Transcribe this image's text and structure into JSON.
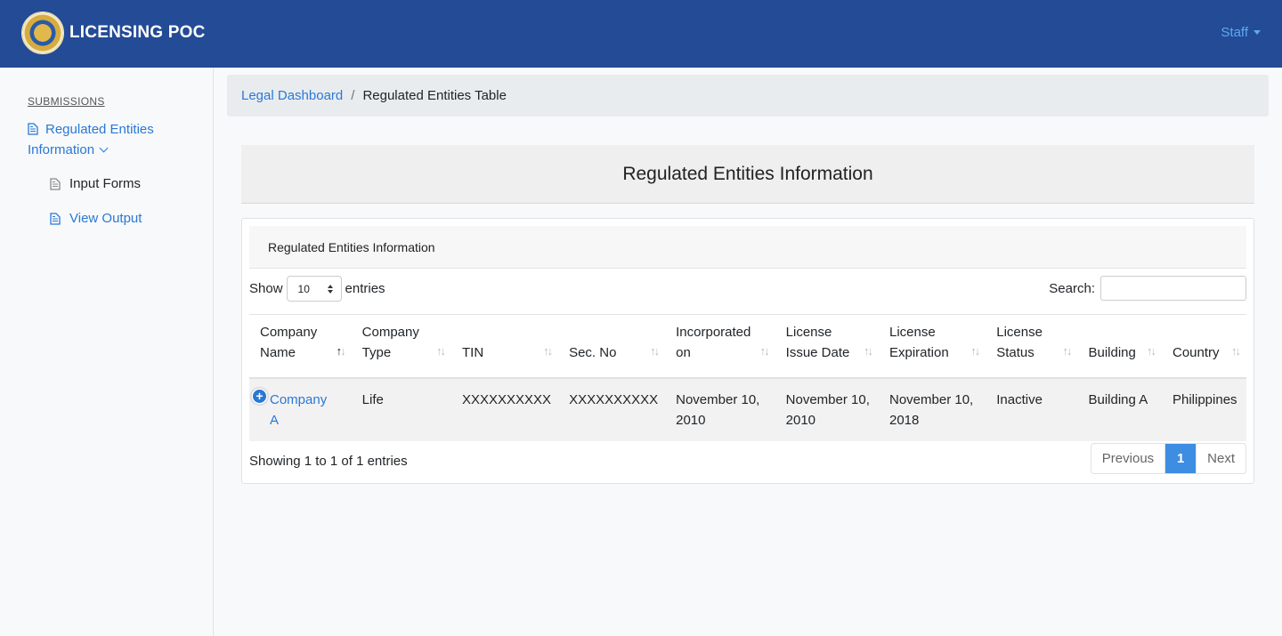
{
  "header": {
    "brand": "LICENSING POC",
    "user_menu": "Staff"
  },
  "sidebar": {
    "heading": "SUBMISSIONS",
    "main_item": "Regulated Entities Information",
    "sub_items": [
      "Input Forms",
      "View Output"
    ]
  },
  "breadcrumb": {
    "parent": "Legal Dashboard",
    "current": "Regulated Entities Table"
  },
  "page": {
    "title": "Regulated Entities Information"
  },
  "card": {
    "title": "Regulated Entities Information",
    "length_prefix": "Show",
    "length_value": "10",
    "length_suffix": "entries",
    "search_label": "Search:",
    "search_value": ""
  },
  "table": {
    "columns": [
      [
        "Company",
        "Name"
      ],
      [
        "Company",
        "Type"
      ],
      [
        "",
        "TIN"
      ],
      [
        "",
        "Sec. No"
      ],
      [
        "Incorporated",
        "on"
      ],
      [
        "License",
        "Issue Date"
      ],
      [
        "License",
        "Expiration"
      ],
      [
        "License",
        "Status"
      ],
      [
        "",
        "Building"
      ],
      [
        "",
        "Country"
      ]
    ],
    "rows": [
      {
        "company": [
          "Company",
          "A"
        ],
        "type": "Life",
        "tin": "XXXXXXXXXX",
        "sec_no": "XXXXXXXXXX",
        "incorporated": [
          "November 10,",
          "2010"
        ],
        "issue_date": [
          "November 10,",
          "2010"
        ],
        "expiration": [
          "November 10,",
          "2018"
        ],
        "status": "Inactive",
        "building": "Building A",
        "country": "Philippines"
      }
    ],
    "info": "Showing 1 to 1 of 1 entries"
  },
  "pagination": {
    "previous": "Previous",
    "current": "1",
    "next": "Next"
  },
  "colors": {
    "navbar": "#234b96",
    "link": "#2a78d6",
    "active_page": "#3d8de2"
  }
}
